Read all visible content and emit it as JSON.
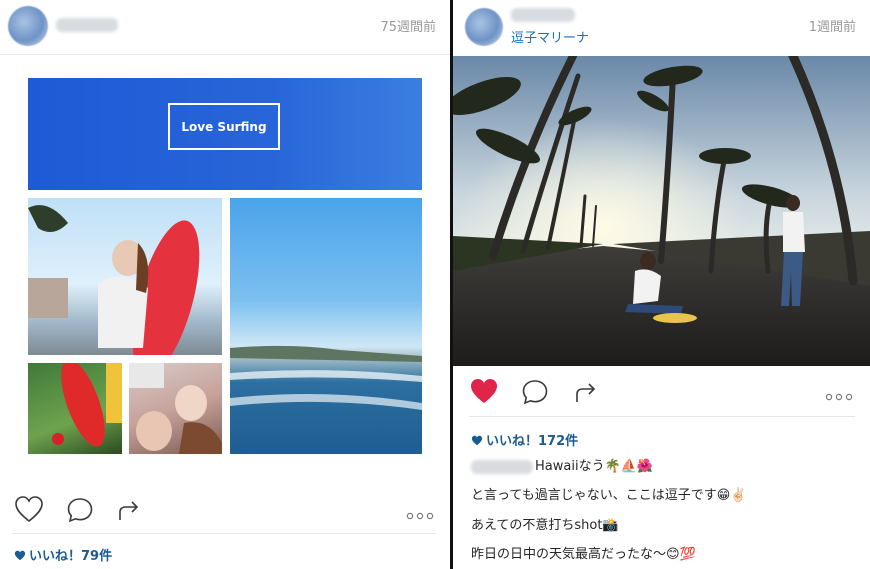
{
  "left_post": {
    "time": "75週間前",
    "banner_text": "Love Surfing",
    "likes": "いいね！79件"
  },
  "right_post": {
    "time": "1週間前",
    "location": "逗子マリーナ",
    "likes": "いいね！172件",
    "caption": [
      "Hawaiiなう🌴⛵🌺",
      "と言っても過言じゃない、ここは逗子です😁✌🏻",
      "あえての不意打ちshot📸",
      "昨日の日中の天気最高だったな〜😊💯"
    ]
  },
  "colors": {
    "heart_liked": "#e0254a",
    "location_link": "#1b6fbf",
    "likes_text": "#1c5b8f",
    "banner_blue": "#2765d8"
  },
  "icons": [
    "heart-icon",
    "comment-icon",
    "share-icon",
    "more-options-icon",
    "likes-heart-icon"
  ]
}
